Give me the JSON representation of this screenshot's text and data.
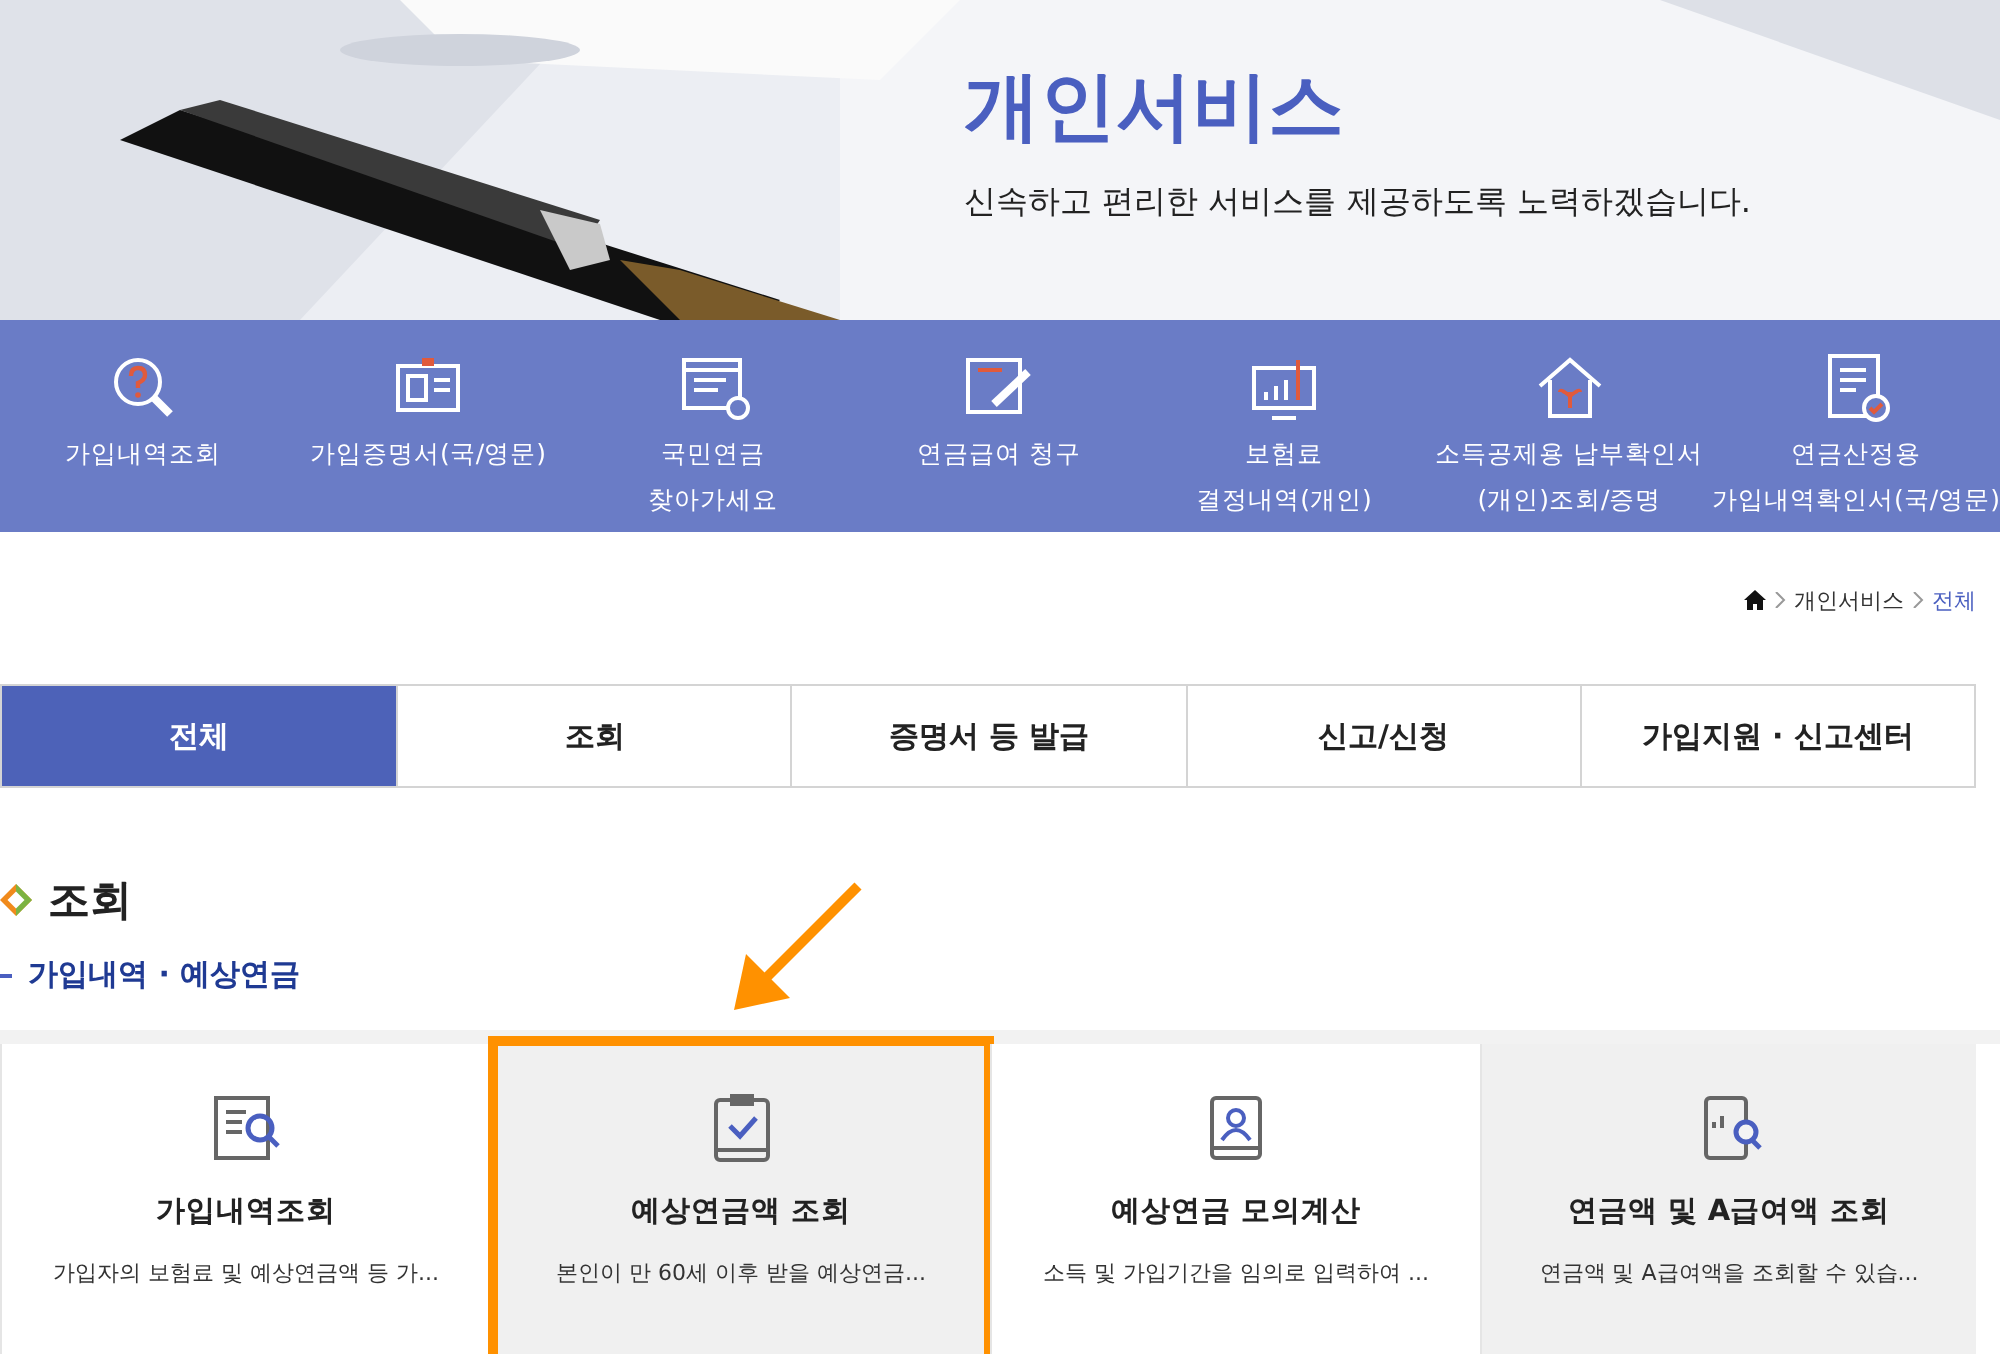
{
  "hero": {
    "title": "개인서비스",
    "subtitle": "신속하고 편리한 서비스를 제공하도록 노력하겠습니다."
  },
  "quick_menu": [
    {
      "kind": "search",
      "lines": [
        "가입내역조회"
      ]
    },
    {
      "kind": "idcard",
      "lines": [
        "가입증명서(국/영문)"
      ]
    },
    {
      "kind": "doc",
      "lines": [
        "국민연금",
        "찾아가세요"
      ]
    },
    {
      "kind": "edit",
      "lines": [
        "연금급여 청구"
      ]
    },
    {
      "kind": "monitor",
      "lines": [
        "보험료",
        "결정내역(개인)"
      ]
    },
    {
      "kind": "house",
      "lines": [
        "소득공제용 납부확인서",
        "(개인)조회/증명"
      ]
    },
    {
      "kind": "check",
      "lines": [
        "연금산정용",
        "가입내역확인서(국/영문)"
      ]
    }
  ],
  "breadcrumb": [
    "개인서비스",
    "전체"
  ],
  "tabs": [
    {
      "label": "전체",
      "selected": true
    },
    {
      "label": "조회",
      "selected": false
    },
    {
      "label": "증명서 등 발급",
      "selected": false
    },
    {
      "label": "신고/신청",
      "selected": false
    },
    {
      "label": "가입지원 · 신고센터",
      "selected": false
    }
  ],
  "section": {
    "title": "조회",
    "subtitle": "가입내역 · 예상연금"
  },
  "cards": [
    {
      "kind": "list",
      "title": "가입내역조회",
      "description": "가입자의 보험료 및 예상연금액 등 가...",
      "shaded": false,
      "marked": false
    },
    {
      "kind": "clipboard",
      "title": "예상연금액 조회",
      "description": "본인이 만 60세 이후 받을 예상연금...",
      "shaded": true,
      "marked": true
    },
    {
      "kind": "person",
      "title": "예상연금 모의계산",
      "description": "소득 및 가입기간을 임의로 입력하여 ...",
      "shaded": false,
      "marked": false
    },
    {
      "kind": "phone",
      "title": "연금액 및 A급여액 조회",
      "description": "연금액 및 A급여액을 조회할 수 있습...",
      "shaded": true,
      "marked": false
    }
  ]
}
